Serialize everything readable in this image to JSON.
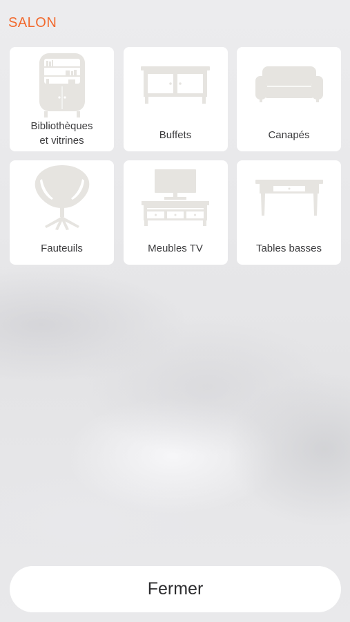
{
  "colors": {
    "accent": "#f26a2e",
    "icon": "#e6e4e0",
    "tile_bg": "#ffffff",
    "label_text": "#3b3b3d"
  },
  "section": {
    "title": "SALON"
  },
  "categories": [
    {
      "label_line1": "Bibliothèques",
      "label_line2": "et vitrines",
      "icon": "bookcase-icon"
    },
    {
      "label": "Buffets",
      "icon": "sideboard-icon"
    },
    {
      "label": "Canapés",
      "icon": "sofa-icon"
    },
    {
      "label": "Fauteuils",
      "icon": "armchair-icon"
    },
    {
      "label": "Meubles TV",
      "icon": "tv-stand-icon"
    },
    {
      "label": "Tables basses",
      "icon": "coffee-table-icon"
    }
  ],
  "footer": {
    "close_label": "Fermer"
  }
}
